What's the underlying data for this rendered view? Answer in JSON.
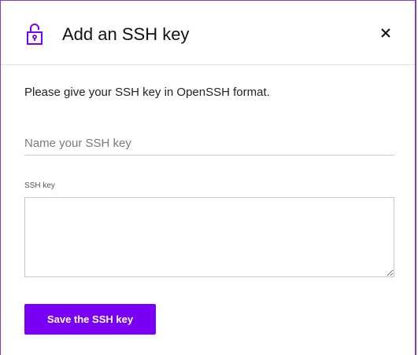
{
  "dialog": {
    "title": "Add an SSH key",
    "icon": "lock-icon",
    "close_icon": "close-icon",
    "accent_color": "#7a00f5"
  },
  "form": {
    "intro": "Please give your SSH key in OpenSSH format.",
    "name_placeholder": "Name your SSH key",
    "name_value": "",
    "key_label": "SSH key",
    "key_value": "",
    "save_label": "Save the SSH key"
  }
}
